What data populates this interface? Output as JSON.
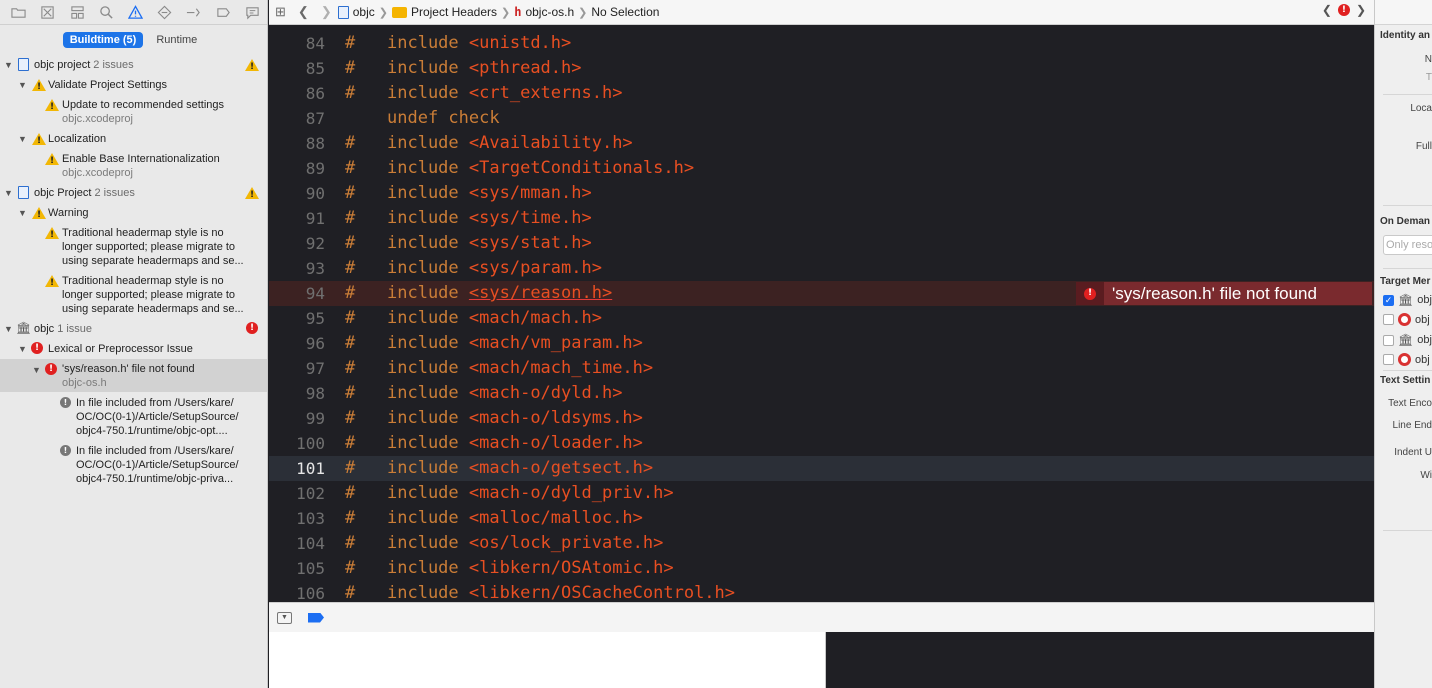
{
  "navigator": {
    "tabs": [
      {
        "name": "project-navigator",
        "icon": "folder-icon"
      },
      {
        "name": "source-control-navigator",
        "icon": "source-control-icon"
      },
      {
        "name": "symbol-navigator",
        "icon": "hierarchy-icon"
      },
      {
        "name": "find-navigator",
        "icon": "search-icon"
      },
      {
        "name": "issue-navigator",
        "icon": "warning-icon"
      },
      {
        "name": "test-navigator",
        "icon": "diamond-icon"
      },
      {
        "name": "debug-navigator",
        "icon": "spray-icon"
      },
      {
        "name": "breakpoint-navigator",
        "icon": "breakpoint-icon"
      },
      {
        "name": "report-navigator",
        "icon": "speech-bubble-icon"
      }
    ],
    "segments": {
      "buildtime": "Buildtime (5)",
      "runtime": "Runtime"
    },
    "issues": [
      {
        "label": "objc project",
        "count": "2 issues"
      },
      {
        "label": "Validate Project Settings"
      },
      {
        "label": "Update to recommended settings",
        "sub": "objc.xcodeproj"
      },
      {
        "label": "Localization"
      },
      {
        "label": "Enable Base Internationalization",
        "sub": "objc.xcodeproj"
      },
      {
        "label": "objc Project",
        "count": "2 issues"
      },
      {
        "label": "Warning"
      },
      {
        "line1": "Traditional headermap style is no",
        "line2": "longer supported; please migrate to",
        "line3": "using separate headermaps and se..."
      },
      {
        "line1": "Traditional headermap style is no",
        "line2": "longer supported; please migrate to",
        "line3": "using separate headermaps and se..."
      },
      {
        "label": "objc",
        "count": "1 issue"
      },
      {
        "label": "Lexical or Preprocessor Issue"
      },
      {
        "label": "'sys/reason.h' file not found",
        "sub": "objc-os.h"
      },
      {
        "line1": "In file included from /Users/kare/",
        "line2": "OC/OC(0-1)/Article/SetupSource/",
        "line3": "objc4-750.1/runtime/objc-opt...."
      },
      {
        "line1": "In file included from /Users/kare/",
        "line2": "OC/OC(0-1)/Article/SetupSource/",
        "line3": "objc4-750.1/runtime/objc-priva..."
      }
    ]
  },
  "jumpbar": {
    "crumbs": [
      "objc",
      "Project Headers",
      "objc-os.h",
      "No Selection"
    ]
  },
  "editor": {
    "lines": [
      {
        "num": "84",
        "hash": "#",
        "kw": "include",
        "path": "<unistd.h>"
      },
      {
        "num": "85",
        "hash": "#",
        "kw": "include",
        "path": "<pthread.h>"
      },
      {
        "num": "86",
        "hash": "#",
        "kw": "include",
        "path": "<crt_externs.h>"
      },
      {
        "num": "87",
        "hash": "",
        "kw": "undef check",
        "path": ""
      },
      {
        "num": "88",
        "hash": "#",
        "kw": "include",
        "path": "<Availability.h>"
      },
      {
        "num": "89",
        "hash": "#",
        "kw": "include",
        "path": "<TargetConditionals.h>"
      },
      {
        "num": "90",
        "hash": "#",
        "kw": "include",
        "path": "<sys/mman.h>"
      },
      {
        "num": "91",
        "hash": "#",
        "kw": "include",
        "path": "<sys/time.h>"
      },
      {
        "num": "92",
        "hash": "#",
        "kw": "include",
        "path": "<sys/stat.h>"
      },
      {
        "num": "93",
        "hash": "#",
        "kw": "include",
        "path": "<sys/param.h>"
      },
      {
        "num": "94",
        "hash": "#",
        "kw": "include",
        "path": "<sys/reason.h>"
      },
      {
        "num": "95",
        "hash": "#",
        "kw": "include",
        "path": "<mach/mach.h>"
      },
      {
        "num": "96",
        "hash": "#",
        "kw": "include",
        "path": "<mach/vm_param.h>"
      },
      {
        "num": "97",
        "hash": "#",
        "kw": "include",
        "path": "<mach/mach_time.h>"
      },
      {
        "num": "98",
        "hash": "#",
        "kw": "include",
        "path": "<mach-o/dyld.h>"
      },
      {
        "num": "99",
        "hash": "#",
        "kw": "include",
        "path": "<mach-o/ldsyms.h>"
      },
      {
        "num": "100",
        "hash": "#",
        "kw": "include",
        "path": "<mach-o/loader.h>"
      },
      {
        "num": "101",
        "hash": "#",
        "kw": "include",
        "path": "<mach-o/getsect.h>"
      },
      {
        "num": "102",
        "hash": "#",
        "kw": "include",
        "path": "<mach-o/dyld_priv.h>"
      },
      {
        "num": "103",
        "hash": "#",
        "kw": "include",
        "path": "<malloc/malloc.h>"
      },
      {
        "num": "104",
        "hash": "#",
        "kw": "include",
        "path": "<os/lock_private.h>"
      },
      {
        "num": "105",
        "hash": "#",
        "kw": "include",
        "path": "<libkern/OSAtomic.h>"
      },
      {
        "num": "106",
        "hash": "#",
        "kw": "include",
        "path": "<libkern/OSCacheControl.h>"
      }
    ],
    "error_message": "'sys/reason.h' file not found"
  },
  "inspector": {
    "identity_header": "Identity an",
    "name_label": "N",
    "type_label": "T",
    "location_label": "Loca",
    "full_path_label": "Full",
    "on_demand_header": "On Deman",
    "on_demand_placeholder": "Only reso",
    "target_header": "Target Mer",
    "targets": [
      {
        "label": "obj",
        "checked": true
      },
      {
        "label": "obj",
        "checked": false
      },
      {
        "label": "obj",
        "checked": false
      },
      {
        "label": "obj",
        "checked": false
      }
    ],
    "text_settings_header": "Text Settin",
    "text_encoding_label": "Text Enco",
    "line_endings_label": "Line End",
    "indent_label": "Indent U",
    "widths_label": "Wi"
  },
  "colors": {
    "accent": "#1d74e8",
    "error": "#e02020",
    "warning": "#f2b705",
    "keyword": "#ca7d37",
    "string": "#e84f22"
  }
}
